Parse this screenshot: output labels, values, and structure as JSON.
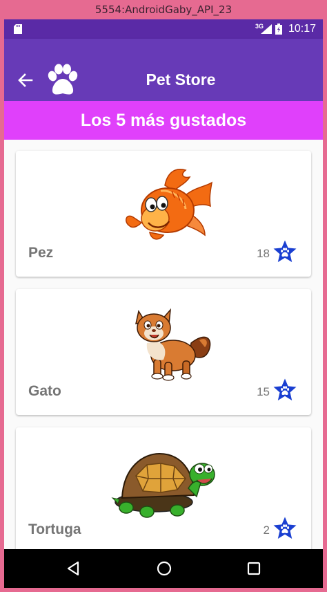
{
  "emulator": {
    "title": "5554:AndroidGaby_API_23"
  },
  "status_bar": {
    "network": "3G",
    "time": "10:17"
  },
  "app_bar": {
    "title": "Pet Store"
  },
  "banner": {
    "title": "Los 5 más gustados"
  },
  "pets": [
    {
      "name": "Pez",
      "likes": "18",
      "image": "fish-image"
    },
    {
      "name": "Gato",
      "likes": "15",
      "image": "cat-image"
    },
    {
      "name": "Tortuga",
      "likes": "2",
      "image": "turtle-image"
    }
  ],
  "colors": {
    "app_bar": "#673ab7",
    "status_bar": "#5a2aa6",
    "banner": "#e040fb",
    "star": "#1a3fd1",
    "frame": "#e66a91"
  }
}
